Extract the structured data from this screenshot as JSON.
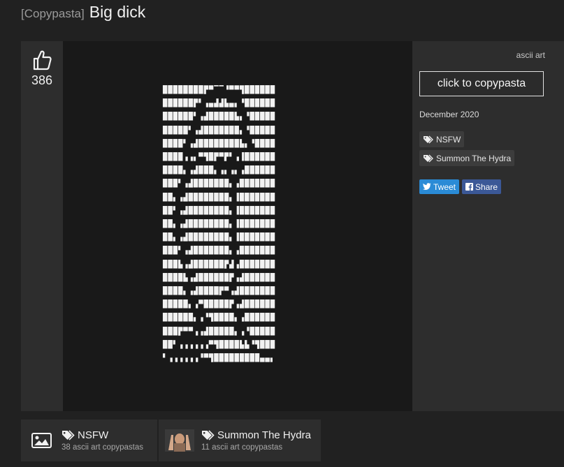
{
  "header": {
    "prefix": "[Copypasta]",
    "title": "Big dick"
  },
  "post": {
    "votes": "386",
    "ascii_art": "████████▛▀▔▔▝▀▀▜██████\n██████▛▘▗▄▟▟▙▄▖▝██████\n██████▘▗▟█████▙▖▝█████\n█████▘▗▟███████▖▝█████\n████▘▗▟████████▙▖▝████\n████▗▗▖▀▜█▛▀▛▘▗▐██████\n████▖▗▟███▖▗▖▗▖▗██████\n███▘▗▟███████▖▗███████\n██▖▗▟████████▖▐███████\n██▘▗▟████████▖▐███████\n██▖▗▟████████▖▐███████\n██▖▗▟████████▖▐███████\n███▘▗▟███████▖▗███████\n███▙▗▟██████▛▟▗███████\n████▙▗▟██████▛▗▟██████\n████▖▗▟████▛▀▗▟███████\n█████▖▗▀█████▛▗▟██████\n██████▖▗▝▜████▖▗██████\n███▛▀▀▗▗▟█████▖▗▝█████\n██▘▗▗▗▗▗▗▀▜████▙▙▝▜███\n▘▗▗▗▗▗▗▝▀▜█████████▄▄▖"
  },
  "sidebar": {
    "category": "ascii art",
    "copy_button": "click to copypasta",
    "date": "December 2020",
    "tags": [
      "NSFW",
      "Summon The Hydra"
    ],
    "share": {
      "tweet": "Tweet",
      "share": "Share"
    }
  },
  "related": [
    {
      "title": "NSFW",
      "subtitle": "38 ascii art copypastas",
      "icon": "image-icon"
    },
    {
      "title": "Summon The Hydra",
      "subtitle": "11 ascii art copypastas",
      "icon": "hydra-thumbnail"
    }
  ],
  "colors": {
    "background": "#212121",
    "panel": "#2d2d2d",
    "art_bg": "#191919",
    "twitter": "#2a8bd6",
    "facebook": "#3b5897"
  }
}
